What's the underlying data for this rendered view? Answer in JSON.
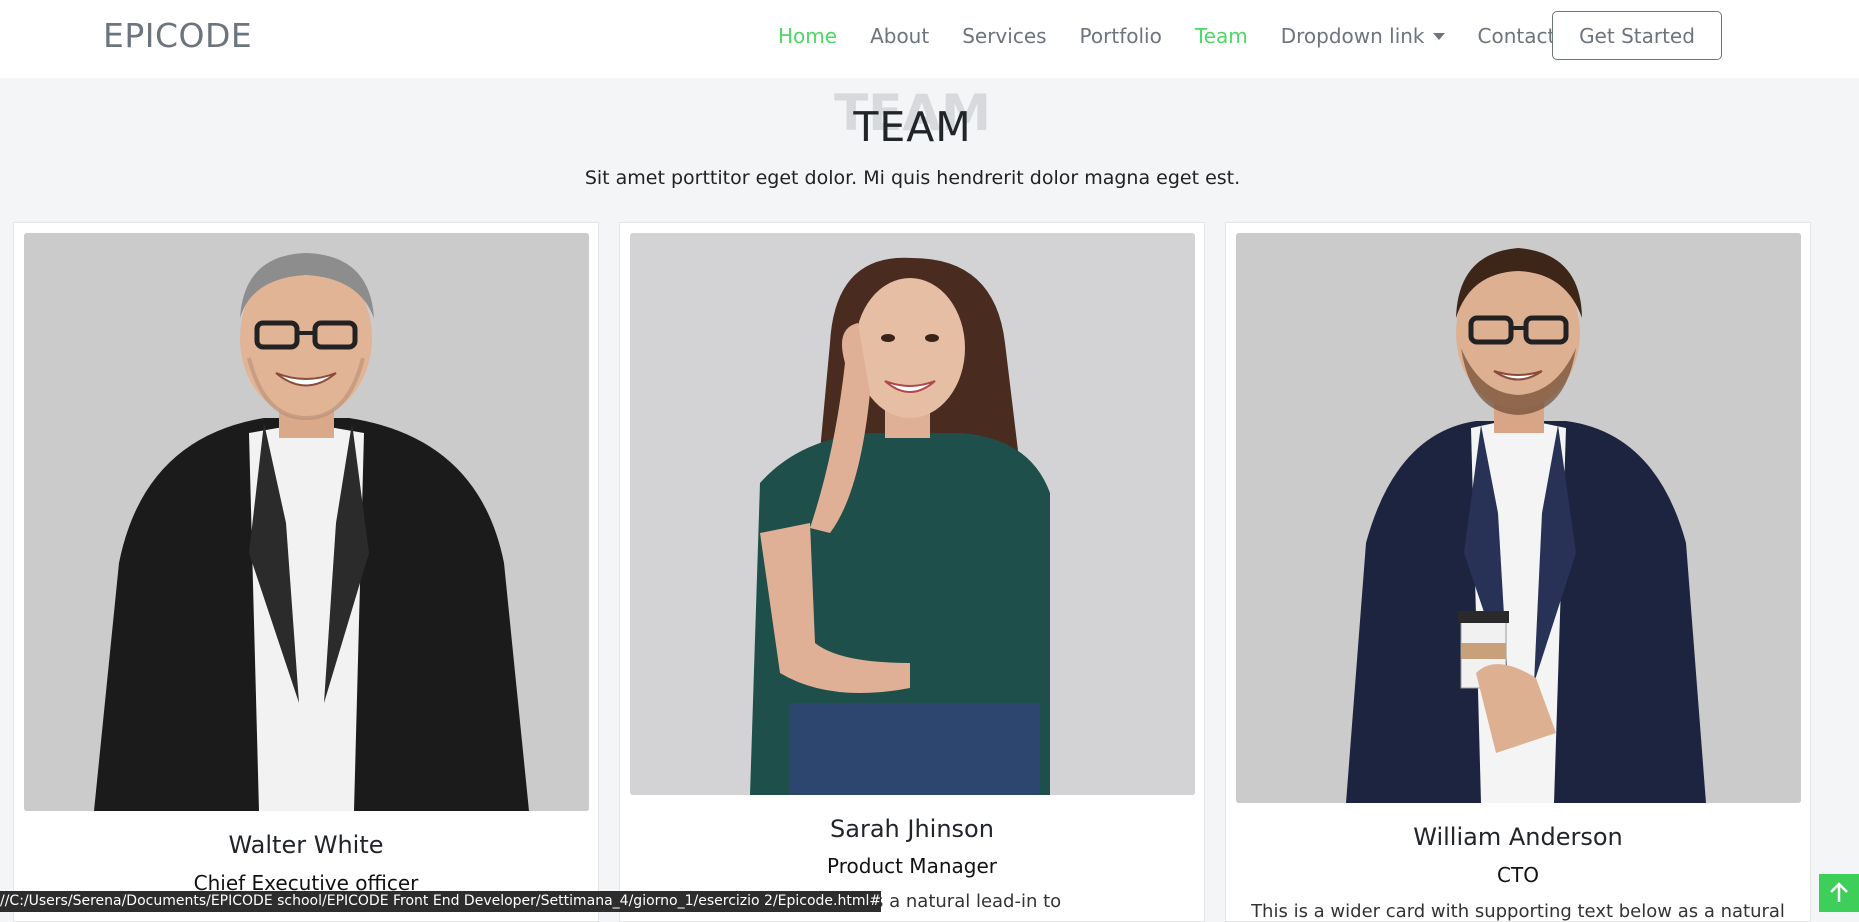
{
  "brand": "EPICODE",
  "nav": {
    "items": [
      {
        "label": "Home",
        "active": true
      },
      {
        "label": "About",
        "active": false
      },
      {
        "label": "Services",
        "active": false
      },
      {
        "label": "Portfolio",
        "active": false
      },
      {
        "label": "Team",
        "active": true
      },
      {
        "label": "Dropdown link",
        "active": false,
        "dropdown": true
      },
      {
        "label": "Contact",
        "active": false
      }
    ],
    "cta_label": "Get Started"
  },
  "section": {
    "title_watermark": "TEAM",
    "title": "TEAM",
    "subtitle": "Sit amet porttitor eget dolor. Mi quis hendrerit dolor magna eget est."
  },
  "team": [
    {
      "name": "Walter White",
      "role": "Chief Executive officer",
      "description": ""
    },
    {
      "name": "Sarah Jhinson",
      "role": "Product Manager",
      "description": "text below as a natural lead-in to"
    },
    {
      "name": "William Anderson",
      "role": "CTO",
      "description": "This is a wider card with supporting text below as a natural"
    }
  ],
  "status_bar": "//C:/Users/Serena/Documents/EPICODE school/EPICODE Front End Developer/Settimana_4/giorno_1/esercizio 2/Epicode.html#team",
  "colors": {
    "accent": "#4cd964",
    "nav_text": "#6c757d",
    "background": "#f4f5f7",
    "back_to_top": "#3ecf5a"
  },
  "icons": {
    "dropdown": "caret-down-icon",
    "back_to_top": "arrow-up-icon"
  }
}
